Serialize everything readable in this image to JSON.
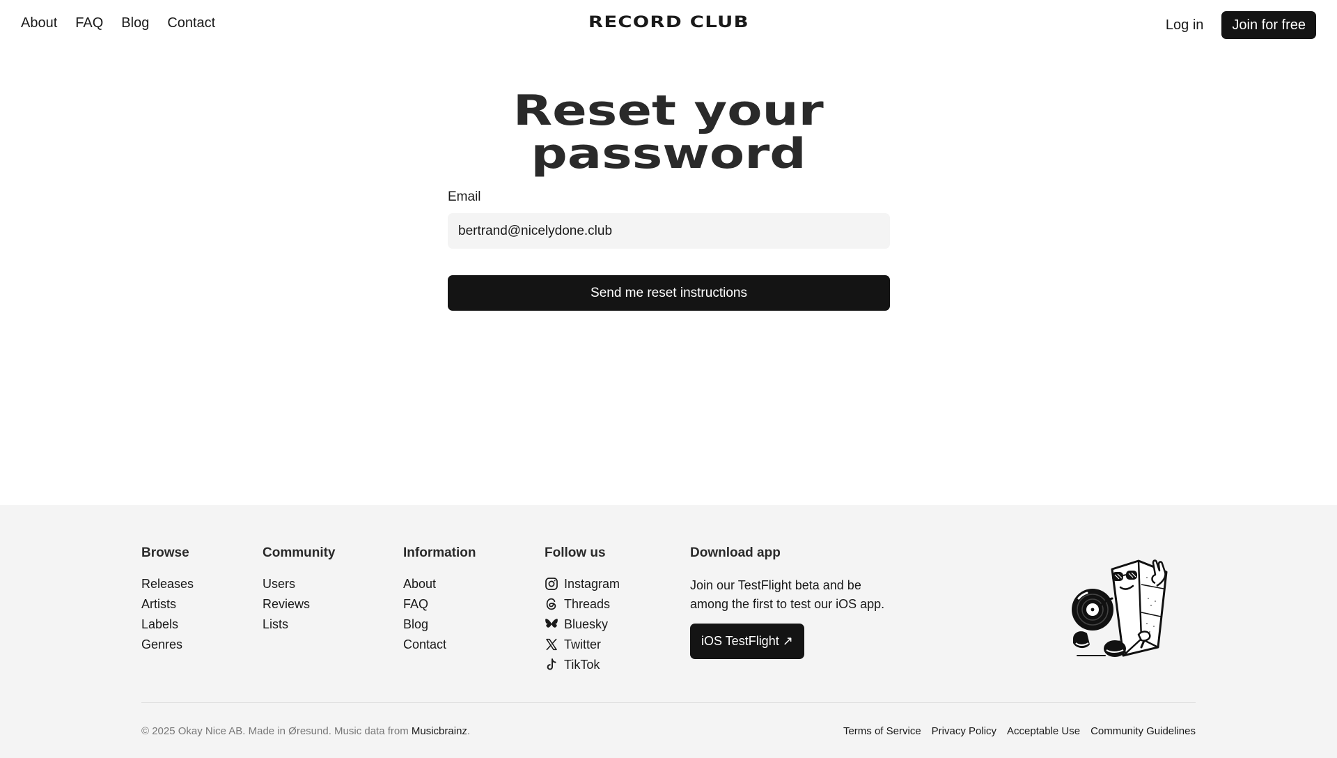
{
  "header": {
    "nav": [
      "About",
      "FAQ",
      "Blog",
      "Contact"
    ],
    "logo": "RECORD CLUB",
    "login": "Log in",
    "join": "Join for free"
  },
  "main": {
    "title_line1": "Reset your",
    "title_line2": "password",
    "email_label": "Email",
    "email_value": "bertrand@nicelydone.club",
    "submit": "Send me reset instructions"
  },
  "footer": {
    "browse": {
      "heading": "Browse",
      "items": [
        "Releases",
        "Artists",
        "Labels",
        "Genres"
      ]
    },
    "community": {
      "heading": "Community",
      "items": [
        "Users",
        "Reviews",
        "Lists"
      ]
    },
    "information": {
      "heading": "Information",
      "items": [
        "About",
        "FAQ",
        "Blog",
        "Contact"
      ]
    },
    "follow": {
      "heading": "Follow us",
      "items": [
        {
          "label": "Instagram",
          "icon": "instagram-icon"
        },
        {
          "label": "Threads",
          "icon": "threads-icon"
        },
        {
          "label": "Bluesky",
          "icon": "bluesky-icon"
        },
        {
          "label": "Twitter",
          "icon": "x-twitter-icon"
        },
        {
          "label": "TikTok",
          "icon": "tiktok-icon"
        }
      ]
    },
    "download": {
      "heading": "Download app",
      "description": "Join our TestFlight beta and be among the first to test our iOS app.",
      "button": "iOS TestFlight ↗"
    },
    "copyright_prefix": "© 2025 Okay Nice AB. Made in Øresund. Music data from ",
    "copyright_link": "Musicbrainz",
    "copyright_suffix": ".",
    "legal": [
      "Terms of Service",
      "Privacy Policy",
      "Acceptable Use",
      "Community Guidelines"
    ]
  }
}
